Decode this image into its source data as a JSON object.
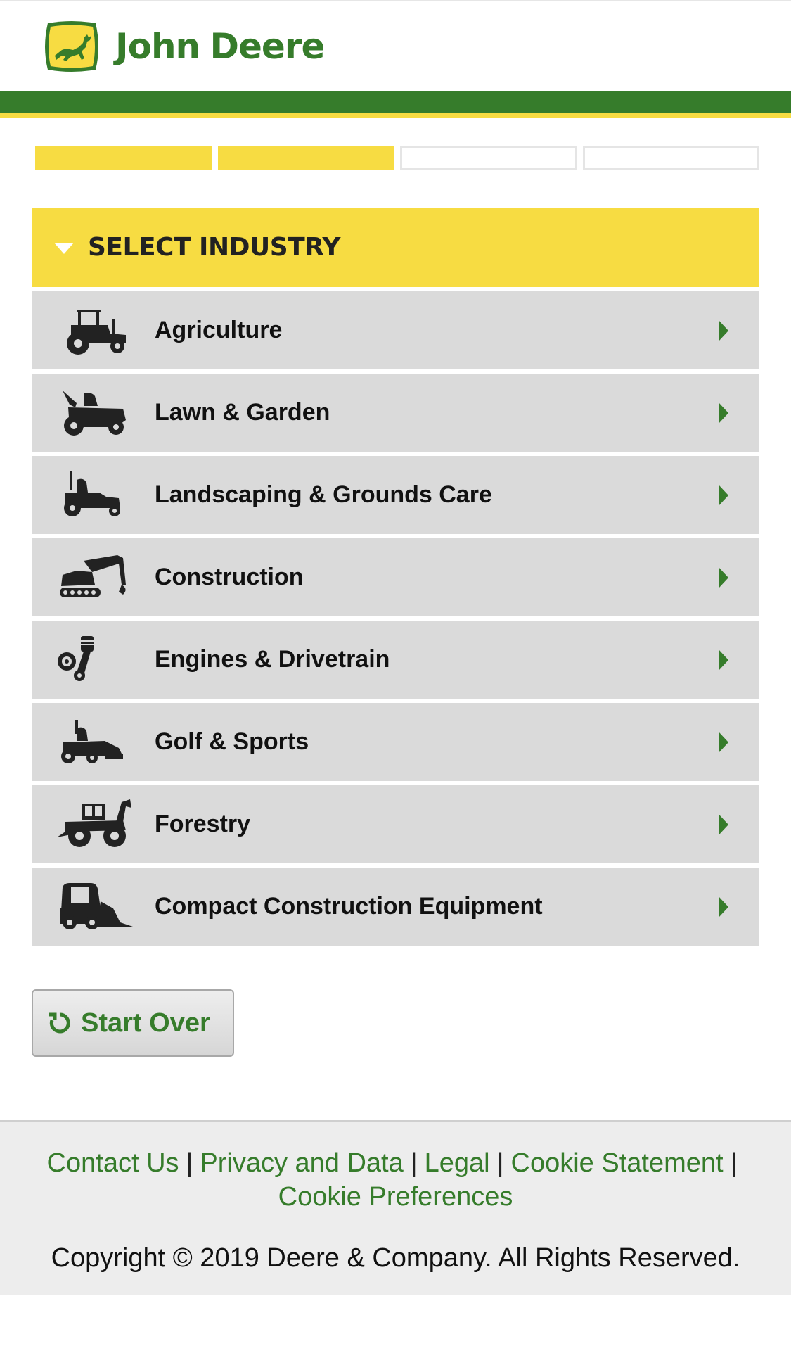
{
  "brand": {
    "name_part1": "John",
    "name_part2": "Deere",
    "colors": {
      "green": "#367c2b",
      "yellow": "#f7dc42"
    }
  },
  "progress": {
    "completed_steps": 2,
    "total_steps": 4
  },
  "panel": {
    "title": "SELECT INDUSTRY",
    "items": [
      {
        "label": "Agriculture",
        "icon": "tractor-icon"
      },
      {
        "label": "Lawn & Garden",
        "icon": "riding-mower-icon"
      },
      {
        "label": "Landscaping & Grounds Care",
        "icon": "zero-turn-mower-icon"
      },
      {
        "label": "Construction",
        "icon": "excavator-icon"
      },
      {
        "label": "Engines & Drivetrain",
        "icon": "piston-gear-icon"
      },
      {
        "label": "Golf & Sports",
        "icon": "golf-mower-icon"
      },
      {
        "label": "Forestry",
        "icon": "skidder-icon"
      },
      {
        "label": "Compact Construction Equipment",
        "icon": "skid-steer-icon"
      }
    ]
  },
  "actions": {
    "start_over": "Start Over"
  },
  "footer": {
    "links": [
      "Contact Us",
      "Privacy and Data",
      "Legal",
      "Cookie Statement",
      "Cookie Preferences"
    ],
    "separator": "|",
    "copyright": "Copyright © 2019 Deere & Company. All Rights Reserved."
  }
}
